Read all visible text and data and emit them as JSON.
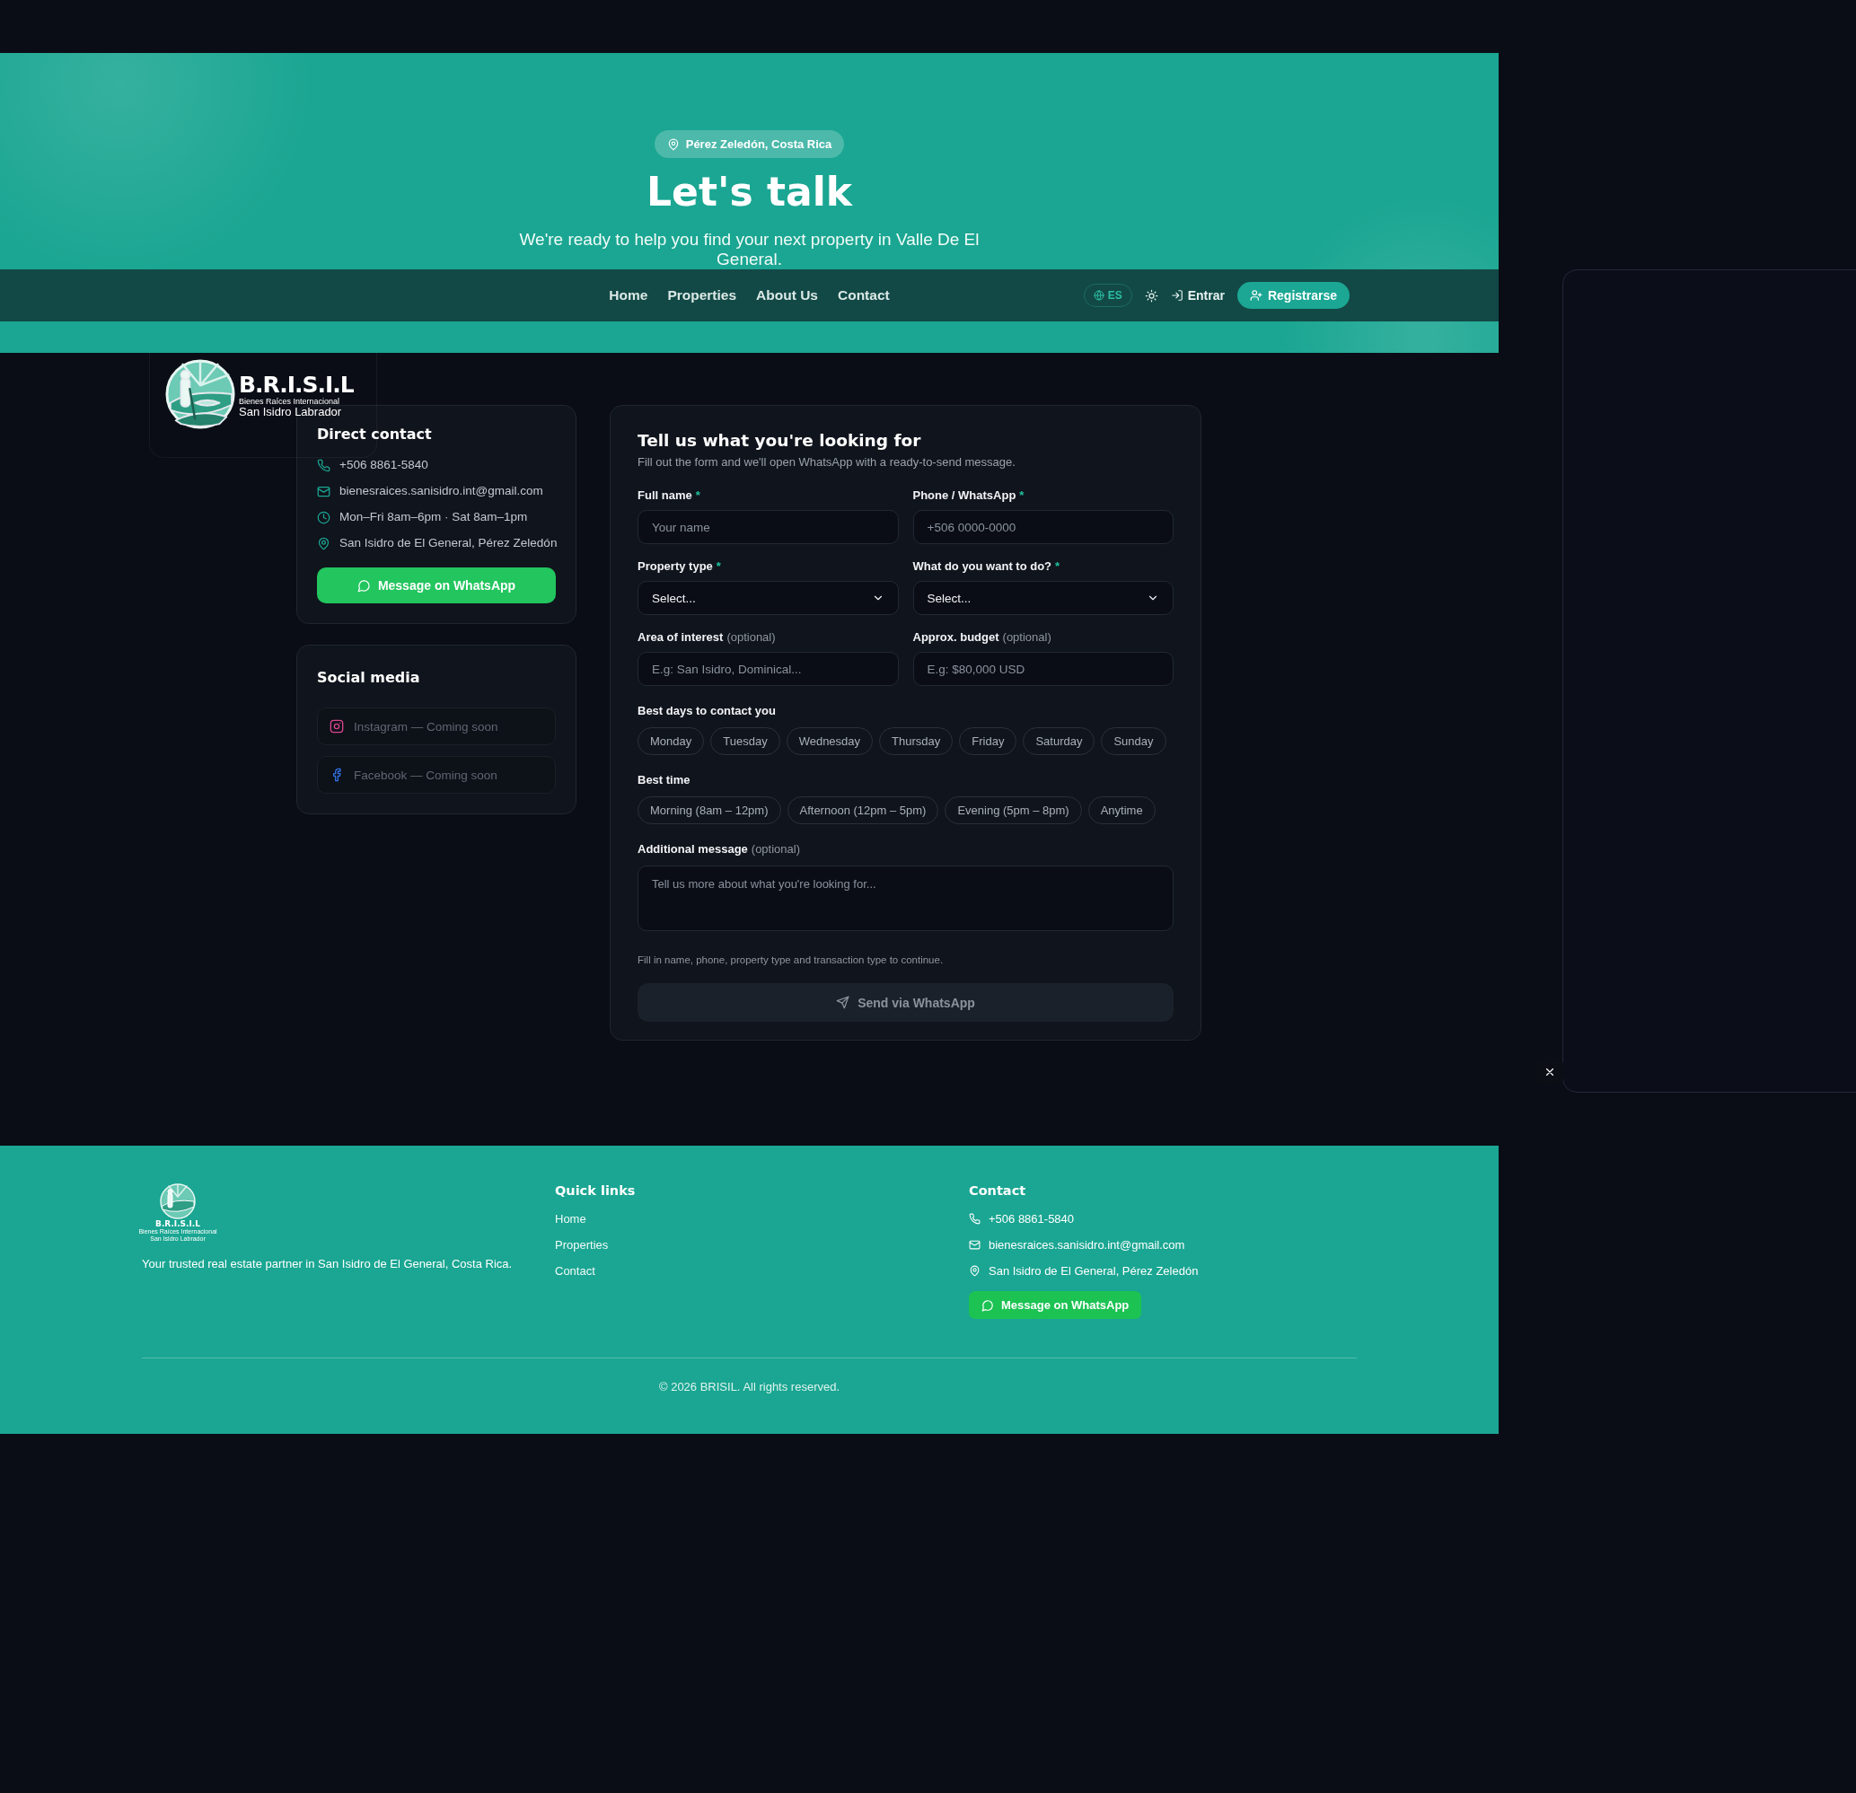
{
  "hero": {
    "location_badge": "Pérez Zeledón, Costa Rica",
    "title": "Let's talk",
    "subtitle": "We're ready to help you find your next property in Valle De El General."
  },
  "navbar": {
    "links": [
      {
        "label": "Home"
      },
      {
        "label": "Properties"
      },
      {
        "label": "About Us"
      },
      {
        "label": "Contact"
      }
    ],
    "language": "ES",
    "login": "Entrar",
    "register": "Registrarse"
  },
  "logo": {
    "name": "B.R.I.S.I.L",
    "line_1": "Bienes Raíces Internacional",
    "line_2": "San Isidro Labrador"
  },
  "direct_contact": {
    "title": "Direct contact",
    "items": [
      {
        "kind": "phone",
        "text": "+506 8861-5840"
      },
      {
        "kind": "email",
        "text": "bienesraices.sanisidro.int@gmail.com"
      },
      {
        "kind": "hours",
        "text": "Mon–Fri 8am–6pm · Sat 8am–1pm"
      },
      {
        "kind": "location",
        "text": "San Isidro de El General, Pérez Zeledón"
      }
    ],
    "button": "Message on WhatsApp"
  },
  "social_media": {
    "title": "Social media",
    "items": [
      {
        "kind": "instagram",
        "label": "Instagram — Coming soon"
      },
      {
        "kind": "facebook",
        "label": "Facebook — Coming soon"
      }
    ]
  },
  "form": {
    "title": "Tell us what you're looking for",
    "subtitle": "Fill out the form and we'll open WhatsApp with a ready-to-send message.",
    "fields": [
      {
        "kind": "input",
        "label": "Full name",
        "required_mark": "*",
        "placeholder": "Your name"
      },
      {
        "kind": "input",
        "label": "Phone / WhatsApp",
        "required_mark": "*",
        "placeholder": "+506 0000-0000"
      },
      {
        "kind": "select",
        "label": "Property type",
        "required_mark": "*",
        "value": "Select..."
      },
      {
        "kind": "select",
        "label": "What do you want to do?",
        "required_mark": "*",
        "value": "Select..."
      },
      {
        "kind": "input",
        "label": "Area of interest",
        "note": "(optional)",
        "placeholder": "E.g: San Isidro, Dominical..."
      },
      {
        "kind": "input",
        "label": "Approx. budget",
        "note": "(optional)",
        "placeholder": "E.g: $80,000 USD"
      }
    ],
    "days": {
      "label": "Best days to contact you",
      "options": [
        {
          "label": "Monday",
          "selected": false
        },
        {
          "label": "Tuesday",
          "selected": false
        },
        {
          "label": "Wednesday",
          "selected": false
        },
        {
          "label": "Thursday",
          "selected": false
        },
        {
          "label": "Friday",
          "selected": false
        },
        {
          "label": "Saturday",
          "selected": false
        },
        {
          "label": "Sunday",
          "selected": false
        }
      ]
    },
    "times": {
      "label": "Best time",
      "options": [
        {
          "label": "Morning (8am – 12pm)",
          "selected": false
        },
        {
          "label": "Afternoon (12pm – 5pm)",
          "selected": false
        },
        {
          "label": "Evening (5pm – 8pm)",
          "selected": false
        },
        {
          "label": "Anytime",
          "selected": false
        }
      ]
    },
    "message": {
      "label": "Additional message",
      "note": "(optional)",
      "placeholder": "Tell us more about what you're looking for..."
    },
    "hint": "Fill in name, phone, property type and transaction type to continue.",
    "submit": {
      "label": "Send via WhatsApp",
      "disabled": true
    }
  },
  "footer": {
    "logo": {
      "name": "B.R.I.S.I.L",
      "line_1": "Bienes Raíces Internacional",
      "line_2": "San Isidro Labrador"
    },
    "tagline": "Your trusted real estate partner in San Isidro de El General, Costa Rica.",
    "quick_links": {
      "title": "Quick links",
      "links": [
        {
          "label": "Home"
        },
        {
          "label": "Properties"
        },
        {
          "label": "Contact"
        }
      ]
    },
    "contact": {
      "title": "Contact",
      "items": [
        {
          "kind": "phone",
          "text": "+506 8861-5840"
        },
        {
          "kind": "email",
          "text": "bienesraices.sanisidro.int@gmail.com"
        },
        {
          "kind": "location",
          "text": "San Isidro de El General, Pérez Zeledón"
        }
      ],
      "button": "Message on WhatsApp"
    },
    "copyright": "© 2026 BRISIL. All rights reserved."
  }
}
